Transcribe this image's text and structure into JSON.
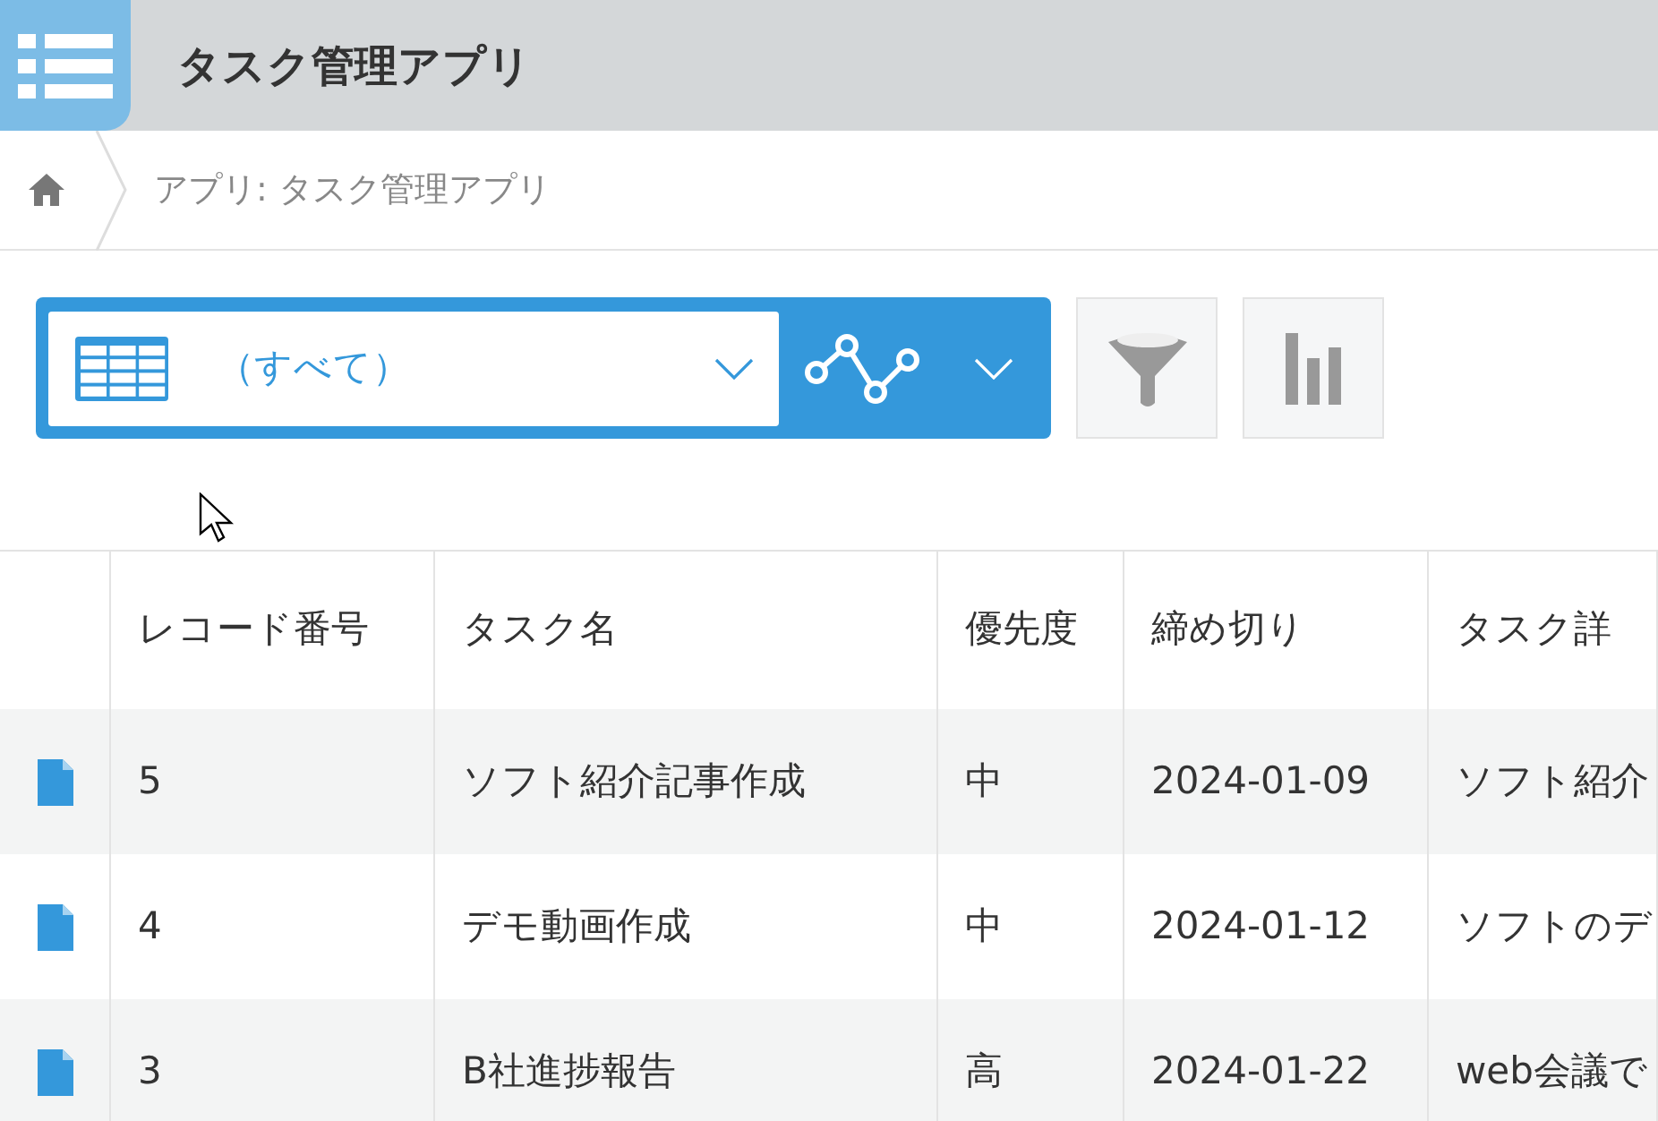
{
  "app_title": "タスク管理アプリ",
  "breadcrumb": "アプリ: タスク管理アプリ",
  "view_selector": {
    "value": "（すべて）"
  },
  "table": {
    "columns": [
      "レコード番号",
      "タスク名",
      "優先度",
      "締め切り",
      "タスク詳"
    ],
    "rows": [
      {
        "cells": [
          "5",
          "ソフト紹介記事作成",
          "中",
          "2024-01-09",
          "ソフト紹介"
        ]
      },
      {
        "cells": [
          "4",
          "デモ動画作成",
          "中",
          "2024-01-12",
          "ソフトのデ"
        ]
      },
      {
        "cells": [
          "3",
          "B社進捗報告",
          "高",
          "2024-01-22",
          "web会議で"
        ]
      }
    ]
  }
}
